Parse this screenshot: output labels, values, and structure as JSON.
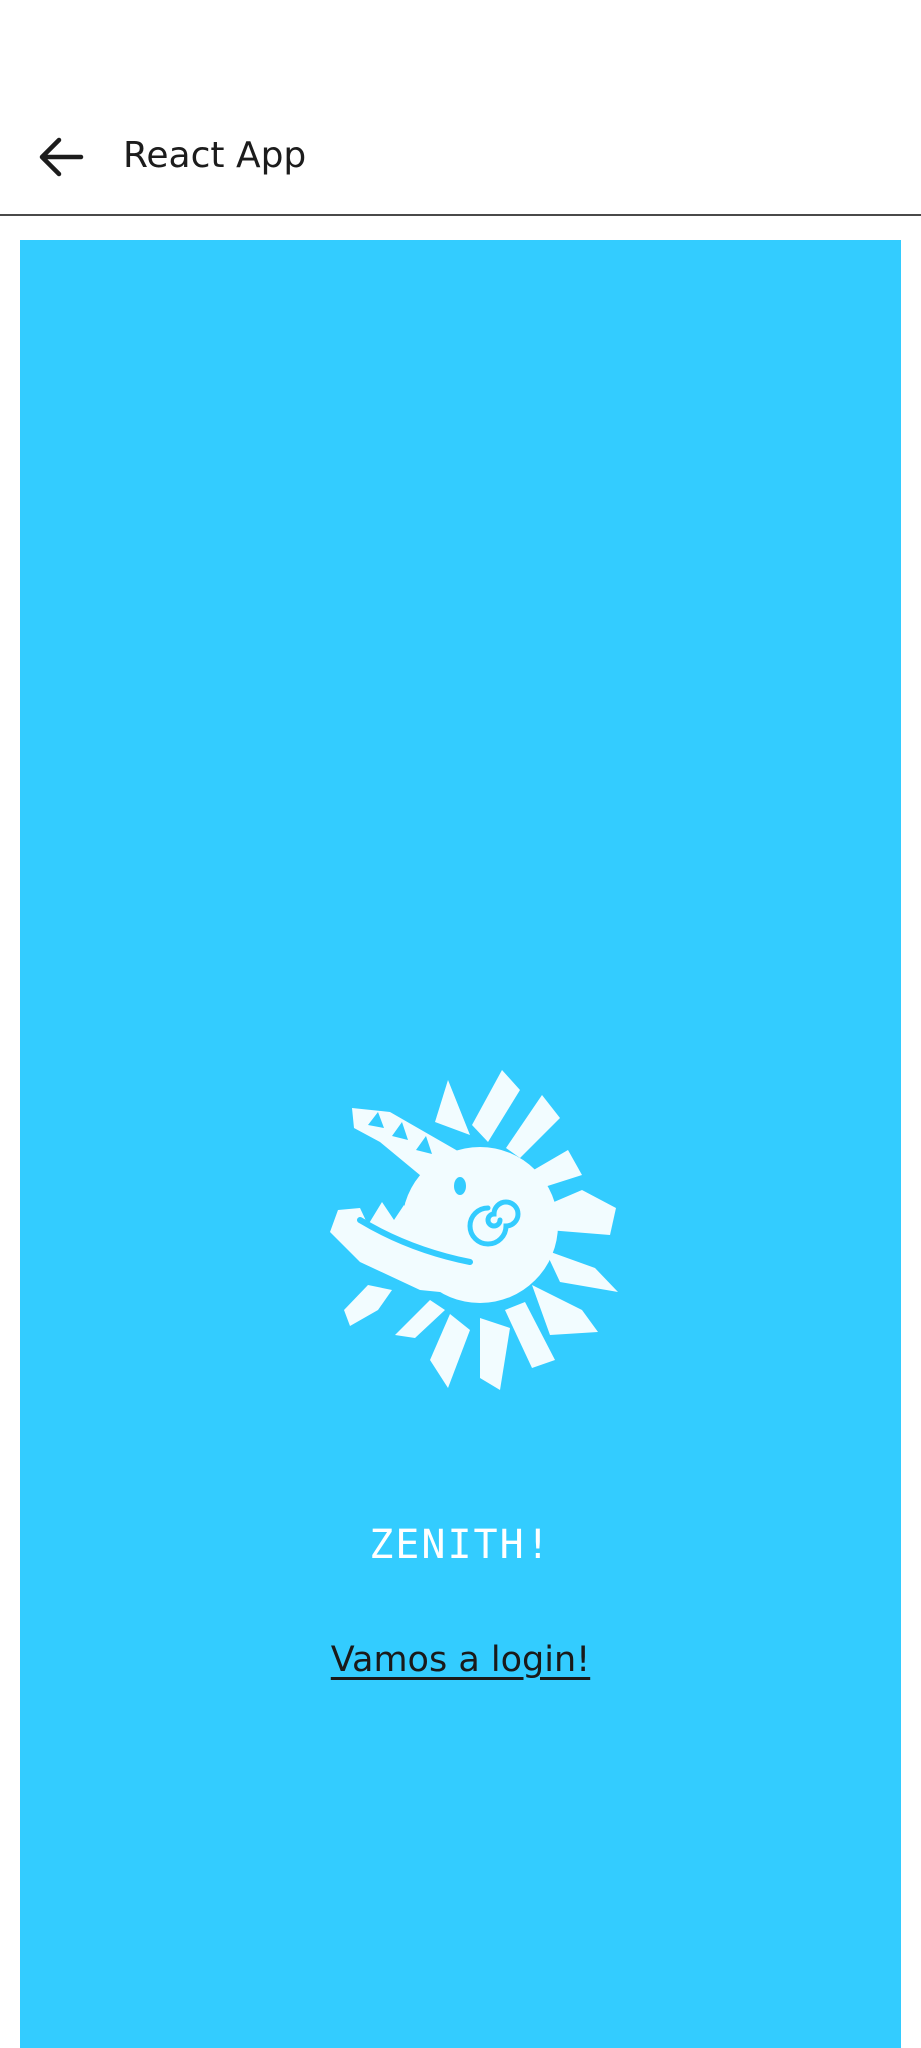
{
  "app_bar": {
    "title": "React App",
    "back_icon": "arrow-left-icon"
  },
  "page": {
    "background_color": "#33ccff",
    "logo_icon": "sun-crocodile-logo",
    "headline": "ZENITH!",
    "login_link": "Vamos a login!"
  }
}
